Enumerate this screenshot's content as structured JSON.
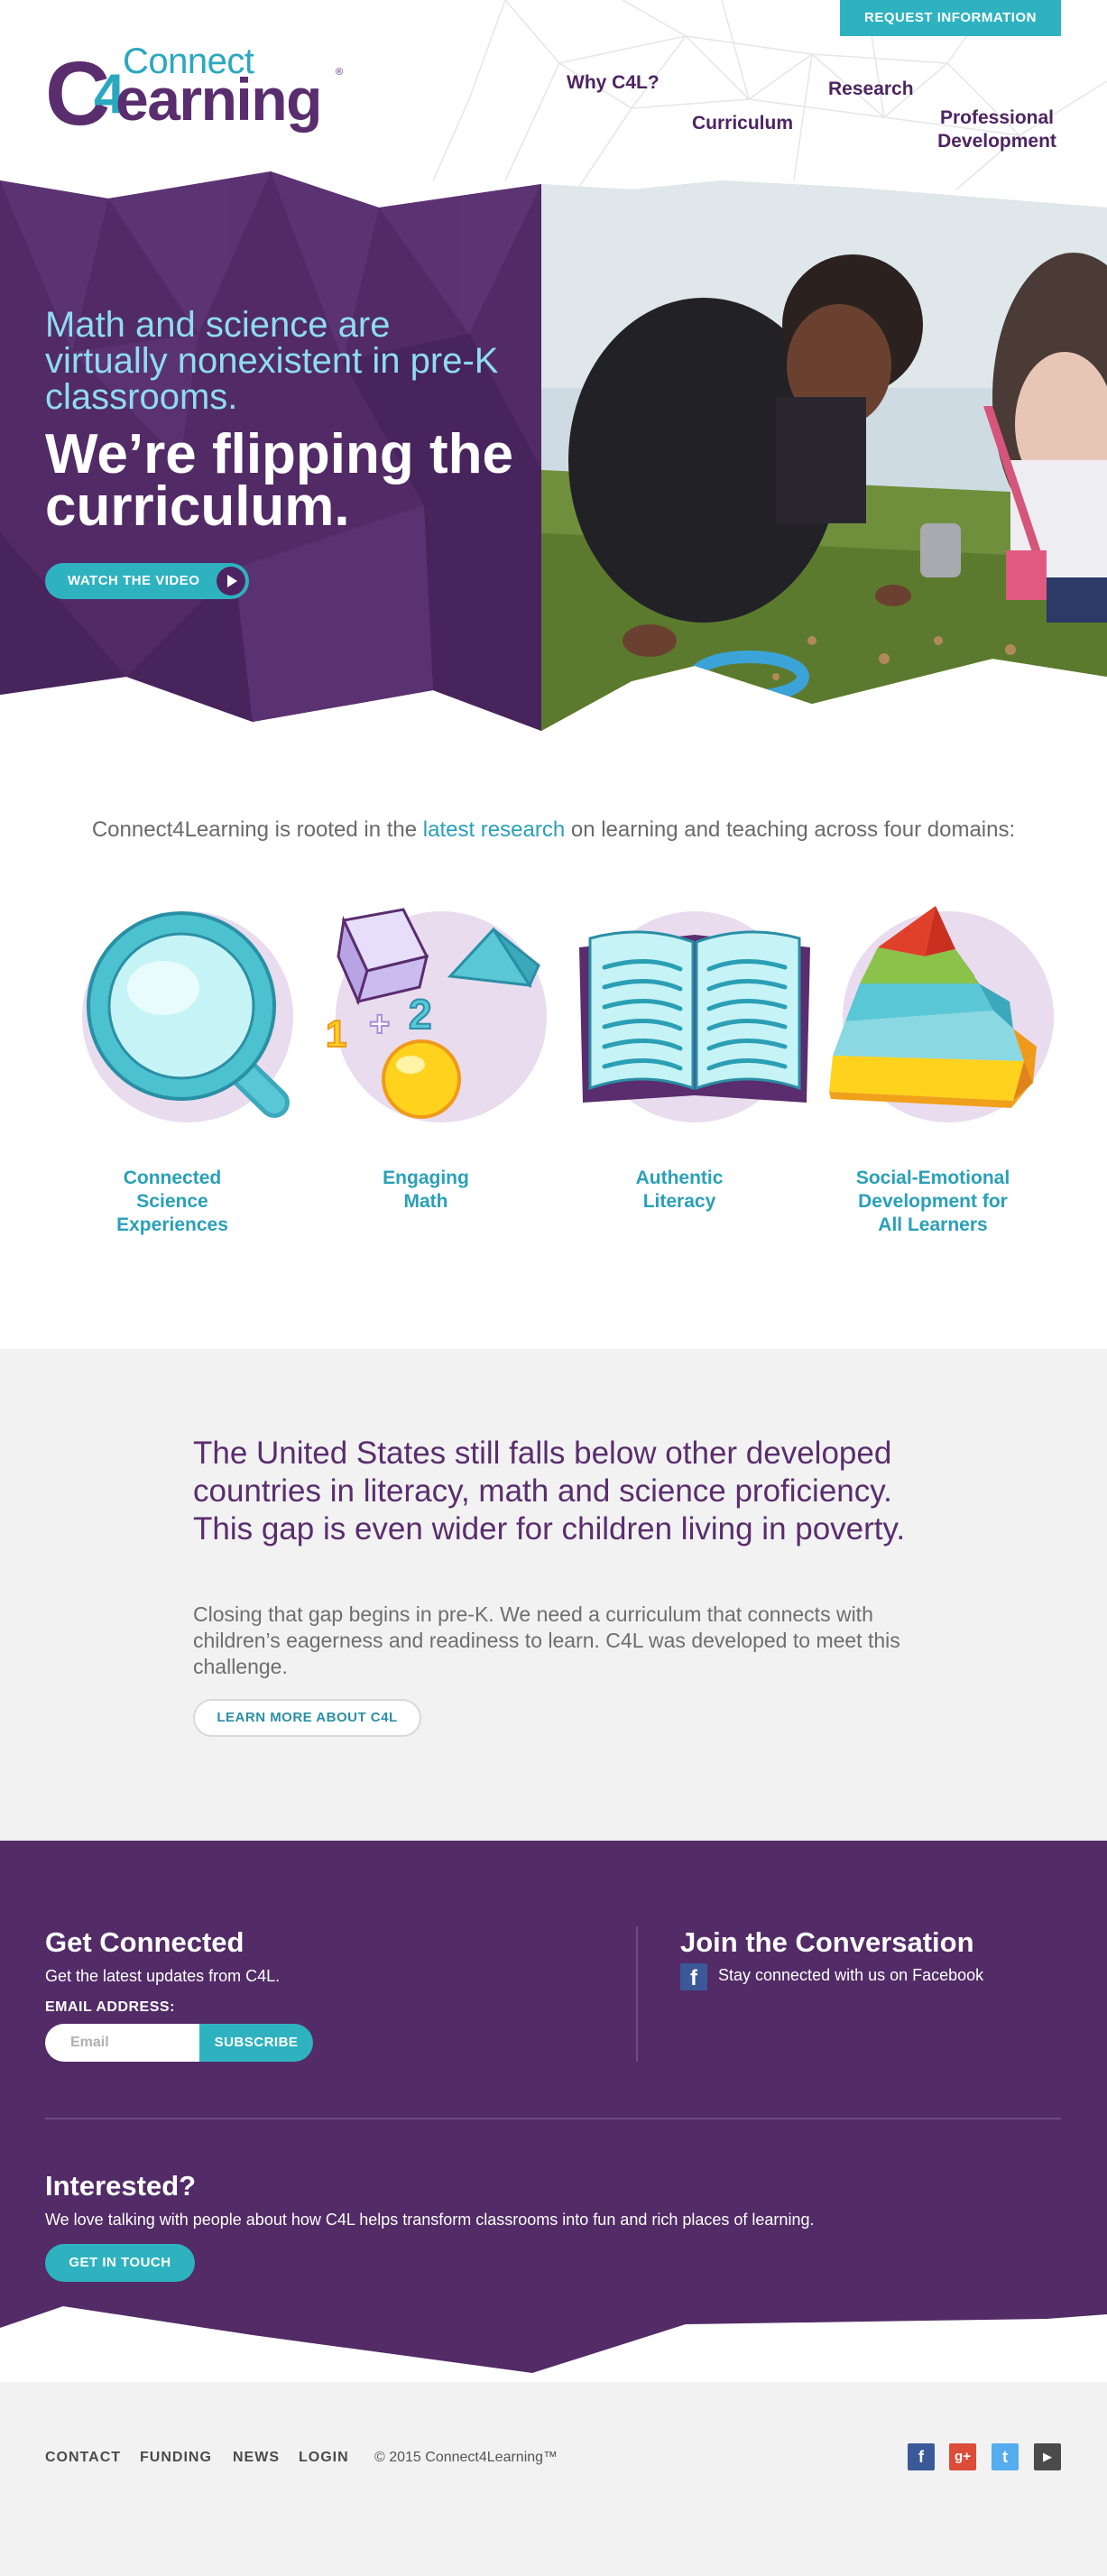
{
  "header": {
    "logo_connect": "Connect",
    "logo_learning": "earning",
    "logo_c": "C",
    "logo_4": "4",
    "logo_reg": "®",
    "request_button": "REQUEST INFORMATION",
    "nav": {
      "why": "Why C4L?",
      "curriculum": "Curriculum",
      "research": "Research",
      "professional_line1": "Professional",
      "professional_line2": "Development"
    }
  },
  "hero": {
    "subtitle": "Math and science are virtually nonexistent in pre-K classrooms.",
    "title": "We’re flipping the curriculum.",
    "video_button": "WATCH THE VIDEO"
  },
  "domains": {
    "intro_before": "Connect4Learning is rooted in the ",
    "intro_link": "latest research",
    "intro_after": " on learning and teaching across four domains:",
    "items": [
      {
        "line1": "Connected",
        "line2": "Science",
        "line3": "Experiences",
        "icon": "magnifier-icon"
      },
      {
        "line1": "Engaging",
        "line2": "Math",
        "line3": "",
        "icon": "math-shapes-icon"
      },
      {
        "line1": "Authentic",
        "line2": "Literacy",
        "line3": "",
        "icon": "open-book-icon"
      },
      {
        "line1": "Social-Emotional",
        "line2": "Development for",
        "line3": "All Learners",
        "icon": "pyramid-icon"
      }
    ]
  },
  "gap": {
    "headline": "The United States still falls below other developed countries in literacy, math and science proficiency. This gap is even wider for children living in poverty.",
    "body": "Closing that gap begins in pre-K. We need a curriculum that connects with children’s eagerness and readiness to learn. C4L was developed to meet this challenge.",
    "button": "LEARN MORE ABOUT C4L"
  },
  "connect": {
    "title": "Get Connected",
    "subtitle": "Get the latest updates from C4L.",
    "email_label": "EMAIL ADDRESS:",
    "email_placeholder": "Email",
    "subscribe": "SUBSCRIBE"
  },
  "conversation": {
    "title": "Join the Conversation",
    "text": "Stay connected with us on Facebook"
  },
  "interested": {
    "title": "Interested?",
    "text": "We love talking with people about how C4L helps transform classrooms into fun and rich places of learning.",
    "button": "GET IN TOUCH"
  },
  "footer": {
    "links": [
      "CONTACT",
      "FUNDING",
      "NEWS",
      "LOGIN"
    ],
    "copyright": "© 2015 Connect4Learning™",
    "social": [
      {
        "icon": "facebook-icon",
        "glyph": "f",
        "color": "#3b5998"
      },
      {
        "icon": "google-plus-icon",
        "glyph": "g+",
        "color": "#dd4b39"
      },
      {
        "icon": "twitter-icon",
        "glyph": "t",
        "color": "#55acee"
      },
      {
        "icon": "youtube-icon",
        "glyph": "▶",
        "color": "#4b4b4b"
      }
    ]
  },
  "colors": {
    "purple": "#522b67",
    "teal": "#2fb2c0",
    "light_teal": "#8fdcef",
    "grey_bg": "#f2f2f2"
  }
}
